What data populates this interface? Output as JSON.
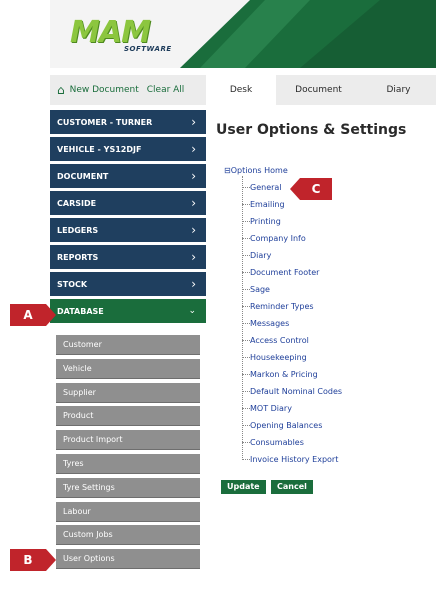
{
  "header": {
    "logo_text": "MAM",
    "logo_sub": "SOFTWARE"
  },
  "toprow": {
    "new_document": "New Document",
    "clear_all": "Clear All"
  },
  "tabs": [
    "Desk",
    "Document",
    "Diary"
  ],
  "sidebar": {
    "items": [
      {
        "label": "CUSTOMER - TURNER"
      },
      {
        "label": "VEHICLE - YS12DJF"
      },
      {
        "label": "DOCUMENT"
      },
      {
        "label": "CARSIDE"
      },
      {
        "label": "LEDGERS"
      },
      {
        "label": "REPORTS"
      },
      {
        "label": "STOCK"
      },
      {
        "label": "DATABASE"
      }
    ],
    "sub_items": [
      {
        "label": "Customer"
      },
      {
        "label": "Vehicle"
      },
      {
        "label": "Supplier"
      },
      {
        "label": "Product"
      },
      {
        "label": "Product Import"
      },
      {
        "label": "Tyres"
      },
      {
        "label": "Tyre Settings"
      },
      {
        "label": "Labour"
      },
      {
        "label": "Custom Jobs"
      },
      {
        "label": "User Options"
      }
    ]
  },
  "main": {
    "title": "User Options & Settings",
    "tree_root": "Options Home",
    "tree_items": [
      "General",
      "Emailing",
      "Printing",
      "Company Info",
      "Diary",
      "Document Footer",
      "Sage",
      "Reminder Types",
      "Messages",
      "Access Control",
      "Housekeeping",
      "Markon & Pricing",
      "Default Nominal Codes",
      "MOT Diary",
      "Opening Balances",
      "Consumables",
      "Invoice History Export"
    ],
    "update_label": "Update",
    "cancel_label": "Cancel"
  },
  "callouts": {
    "a": "A",
    "b": "B",
    "c": "C"
  },
  "colors": {
    "nav_blue": "#1f3f5f",
    "brand_green": "#1a6d3c",
    "sub_grey": "#8f8f8f",
    "callout_red": "#c0242b",
    "link_blue": "#1f3f9a"
  }
}
